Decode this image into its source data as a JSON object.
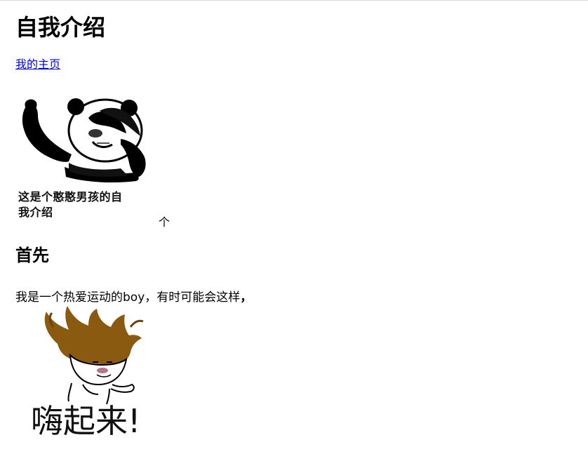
{
  "page": {
    "title": "自我介绍",
    "home_link": "我的主页",
    "image1": {
      "icon": "panda-meme-image",
      "caption_line1": "这是个憨憨男孩的自",
      "caption_line2": "我介绍"
    },
    "after_image_text": "个",
    "section_heading": "首先",
    "paragraph": "我是一个热爱运动的boy，有时可能会这样",
    "paragraph_trailing": "，",
    "image2": {
      "icon": "wild-hair-meme-image",
      "caption": "嗨起来!"
    }
  }
}
